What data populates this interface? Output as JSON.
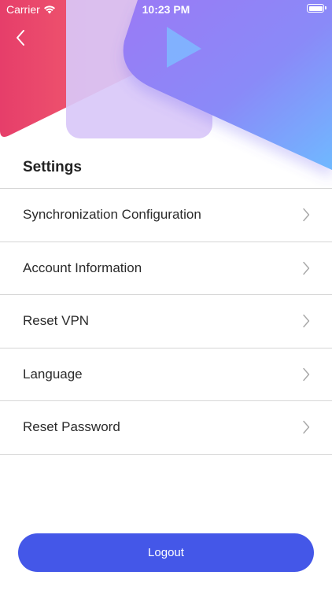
{
  "status_bar": {
    "carrier": "Carrier",
    "time": "10:23 PM"
  },
  "settings": {
    "title": "Settings",
    "items": [
      {
        "label": "Synchronization Configuration"
      },
      {
        "label": "Account Information"
      },
      {
        "label": "Reset VPN"
      },
      {
        "label": "Language"
      },
      {
        "label": "Reset Password"
      }
    ]
  },
  "logout": {
    "label": "Logout"
  },
  "icons": {
    "back": "chevron-left-icon",
    "row": "chevron-right-icon",
    "hero": "play-icon",
    "wifi": "wifi-icon",
    "battery": "battery-icon"
  },
  "colors": {
    "accent": "#4457e8",
    "hero_pink": "#ef4c6c",
    "hero_purple": "#8a7cf6",
    "hero_blue": "#72b3ff"
  }
}
